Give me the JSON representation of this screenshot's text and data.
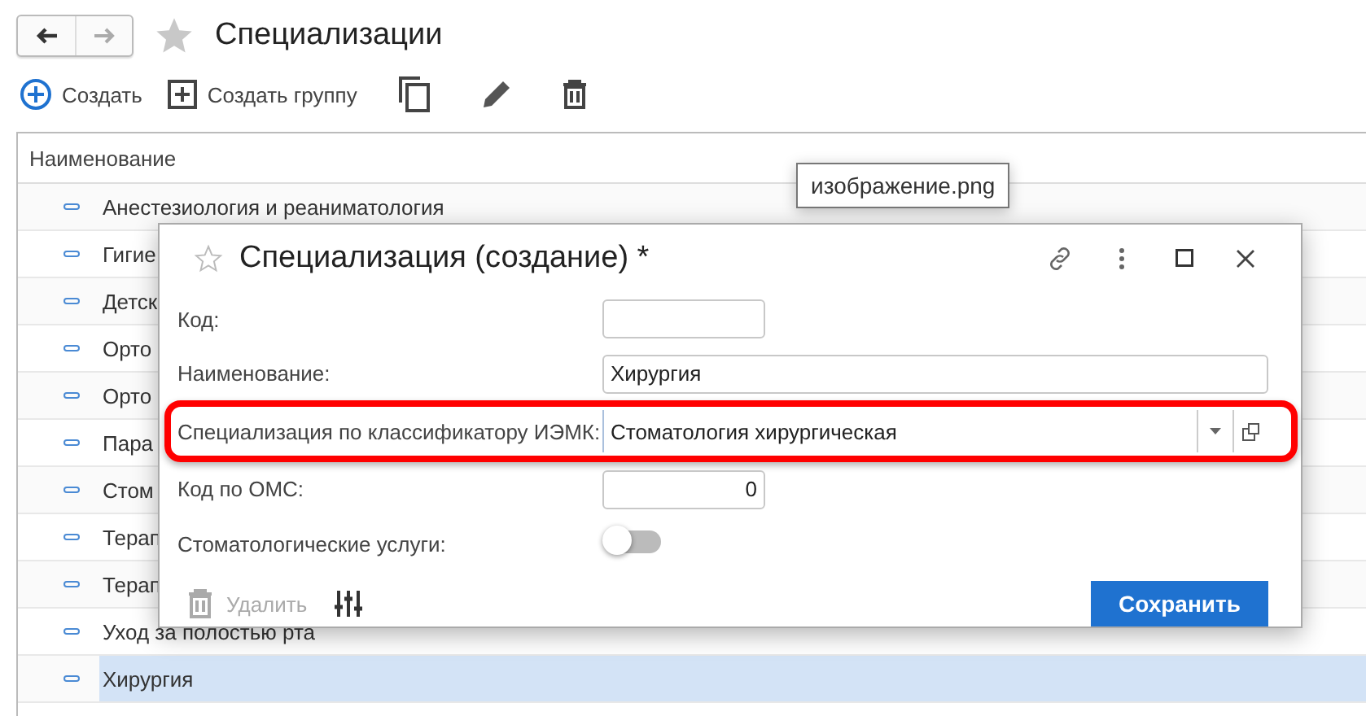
{
  "page": {
    "title": "Специализации",
    "favorite": false
  },
  "toolbar": [
    {
      "kind": "create",
      "label": "Создать"
    },
    {
      "kind": "group",
      "label": "Создать группу"
    },
    {
      "kind": "copy"
    },
    {
      "kind": "edit"
    },
    {
      "kind": "delete"
    }
  ],
  "table": {
    "columns": [
      "Наименование"
    ],
    "rows": [
      {
        "name": "Анестезиология и реаниматология",
        "selected": false
      },
      {
        "name": "Гигие",
        "selected": false
      },
      {
        "name": "Детск",
        "selected": false
      },
      {
        "name": "Орто",
        "selected": false
      },
      {
        "name": "Орто",
        "selected": false
      },
      {
        "name": "Пара",
        "selected": false
      },
      {
        "name": "Стом",
        "selected": false
      },
      {
        "name": "Терап",
        "selected": false
      },
      {
        "name": "Терап",
        "selected": false
      },
      {
        "name": "Уход за полостью рта",
        "selected": false
      },
      {
        "name": "Хирургия",
        "selected": true
      }
    ]
  },
  "tooltip": "изображение.png",
  "dialog": {
    "title": "Специализация (создание) *",
    "favorite": false,
    "fields": [
      {
        "kind": "short",
        "label": "Код:",
        "highlighted": false
      },
      {
        "kind": "wide",
        "label": "Наименование:",
        "value": "Хирургия",
        "highlighted": false
      },
      {
        "kind": "combo",
        "label": "Специализация по классификатору ИЭМК:",
        "value": "Стоматология хирургическая",
        "highlighted": true
      },
      {
        "kind": "number",
        "label": "Код по ОМС:",
        "value": "0",
        "highlighted": false
      },
      {
        "kind": "toggle",
        "label": "Стоматологические услуги:",
        "on": false,
        "highlighted": false
      }
    ],
    "delete": {
      "label": "Удалить",
      "disabled": true
    },
    "save": {
      "label": "Сохранить"
    }
  }
}
